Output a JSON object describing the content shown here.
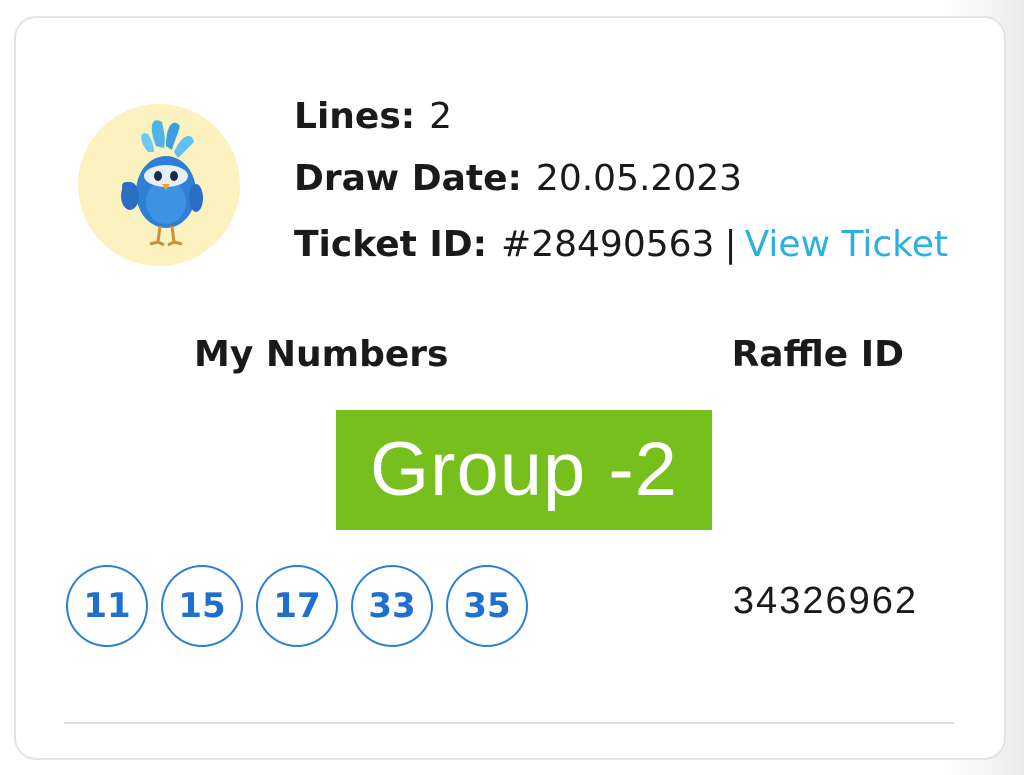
{
  "ticket": {
    "lines_label": "Lines:",
    "lines_value": "2",
    "draw_date_label": "Draw Date:",
    "draw_date_value": "20.05.2023",
    "ticket_id_label": "Ticket ID:",
    "ticket_id_value": "#28490563",
    "separator": "|",
    "view_ticket_label": "View Ticket",
    "avatar_icon": "bird-mascot-icon"
  },
  "columns": {
    "my_numbers": "My Numbers",
    "raffle_id": "Raffle ID"
  },
  "group": {
    "label": "Group -2",
    "color": "#76bf1c"
  },
  "numbers": [
    "11",
    "15",
    "17",
    "33",
    "35"
  ],
  "raffle_id_value": "34326962",
  "colors": {
    "link": "#2bb0e0",
    "ball_border": "#2a7fd6",
    "ball_text": "#1f6fcf",
    "avatar_bg": "#fbf2c0"
  }
}
